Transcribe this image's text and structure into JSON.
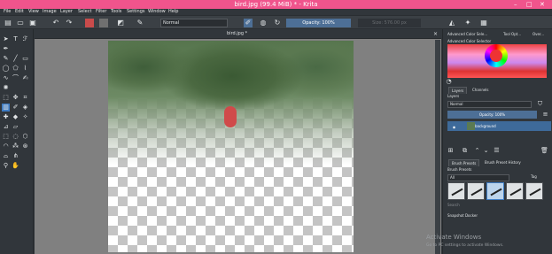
{
  "window": {
    "title": "bird.jpg (99.4 MiB) * - Krita"
  },
  "menu": [
    "File",
    "Edit",
    "View",
    "Image",
    "Layer",
    "Select",
    "Filter",
    "Tools",
    "Settings",
    "Window",
    "Help"
  ],
  "toolbar": {
    "blend_mode": "Normal",
    "opacity_label": "Opacity: 100%",
    "size_label": "Size: 576.00 px",
    "fg_color": "#c94b4b",
    "bg_color": "#707070"
  },
  "document": {
    "tab_title": "bird.jpg *",
    "close": "×"
  },
  "dock": {
    "tabs": [
      "Advanced Color Sele...",
      "Tool Opt...",
      "Over..."
    ],
    "color_selector_title": "Advanced Color Selector",
    "layers_tabs": [
      "Layers",
      "Channels"
    ],
    "layer_blend": "Normal",
    "layer_opacity": "Opacity: 100%",
    "layers": [
      {
        "name": "background"
      }
    ],
    "brush_tabs": [
      "Brush Presets",
      "Brush Preset History"
    ],
    "brush_presets_title": "Brush Presets",
    "brush_filter": "All",
    "tag_label": "Tag",
    "search_placeholder": "Search",
    "snapshot_title": "Snapshot Docker"
  },
  "watermark": {
    "line1": "Activate Windows",
    "line2": "Go to PC settings to activate Windows."
  }
}
